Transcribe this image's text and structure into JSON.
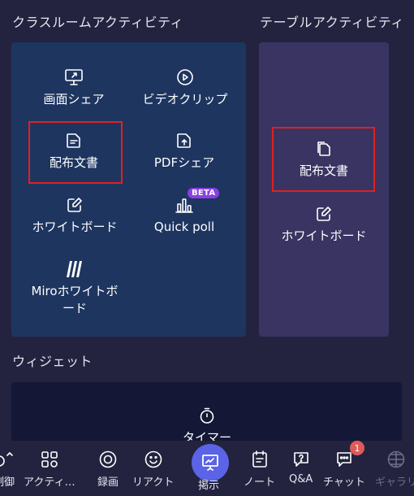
{
  "sections": {
    "class_activities": "クラスルームアクティビティ",
    "table_activities": "テーブルアクティビティ",
    "widgets": "ウィジェット"
  },
  "class_tiles": {
    "screen_share": "画面シェア",
    "video_clip": "ビデオクリップ",
    "handout": "配布文書",
    "pdf_share": "PDFシェア",
    "whiteboard": "ホワイトボード",
    "quick_poll": "Quick poll",
    "quick_poll_badge": "BETA",
    "miro_whiteboard": "Miroホワイトボード"
  },
  "table_tiles": {
    "handout": "配布文書",
    "whiteboard": "ホワイトボード"
  },
  "widgets": {
    "timer": "タイマー"
  },
  "toolbar": {
    "control": "制御",
    "activities": "アクティ…",
    "record": "録画",
    "reaction": "リアクト",
    "present": "掲示",
    "notes": "ノート",
    "qa": "Q&A",
    "chat": "チャット",
    "chat_badge": "1",
    "gallery": "ギャラリ"
  },
  "colors": {
    "background": "#23233f",
    "class_panel": "#1e3560",
    "table_panel": "#3a3462",
    "widget_panel": "#141735",
    "accent": "#5b63e6",
    "highlight": "#e02020",
    "beta": "#8a3fe6",
    "badge": "#e05a5a"
  }
}
